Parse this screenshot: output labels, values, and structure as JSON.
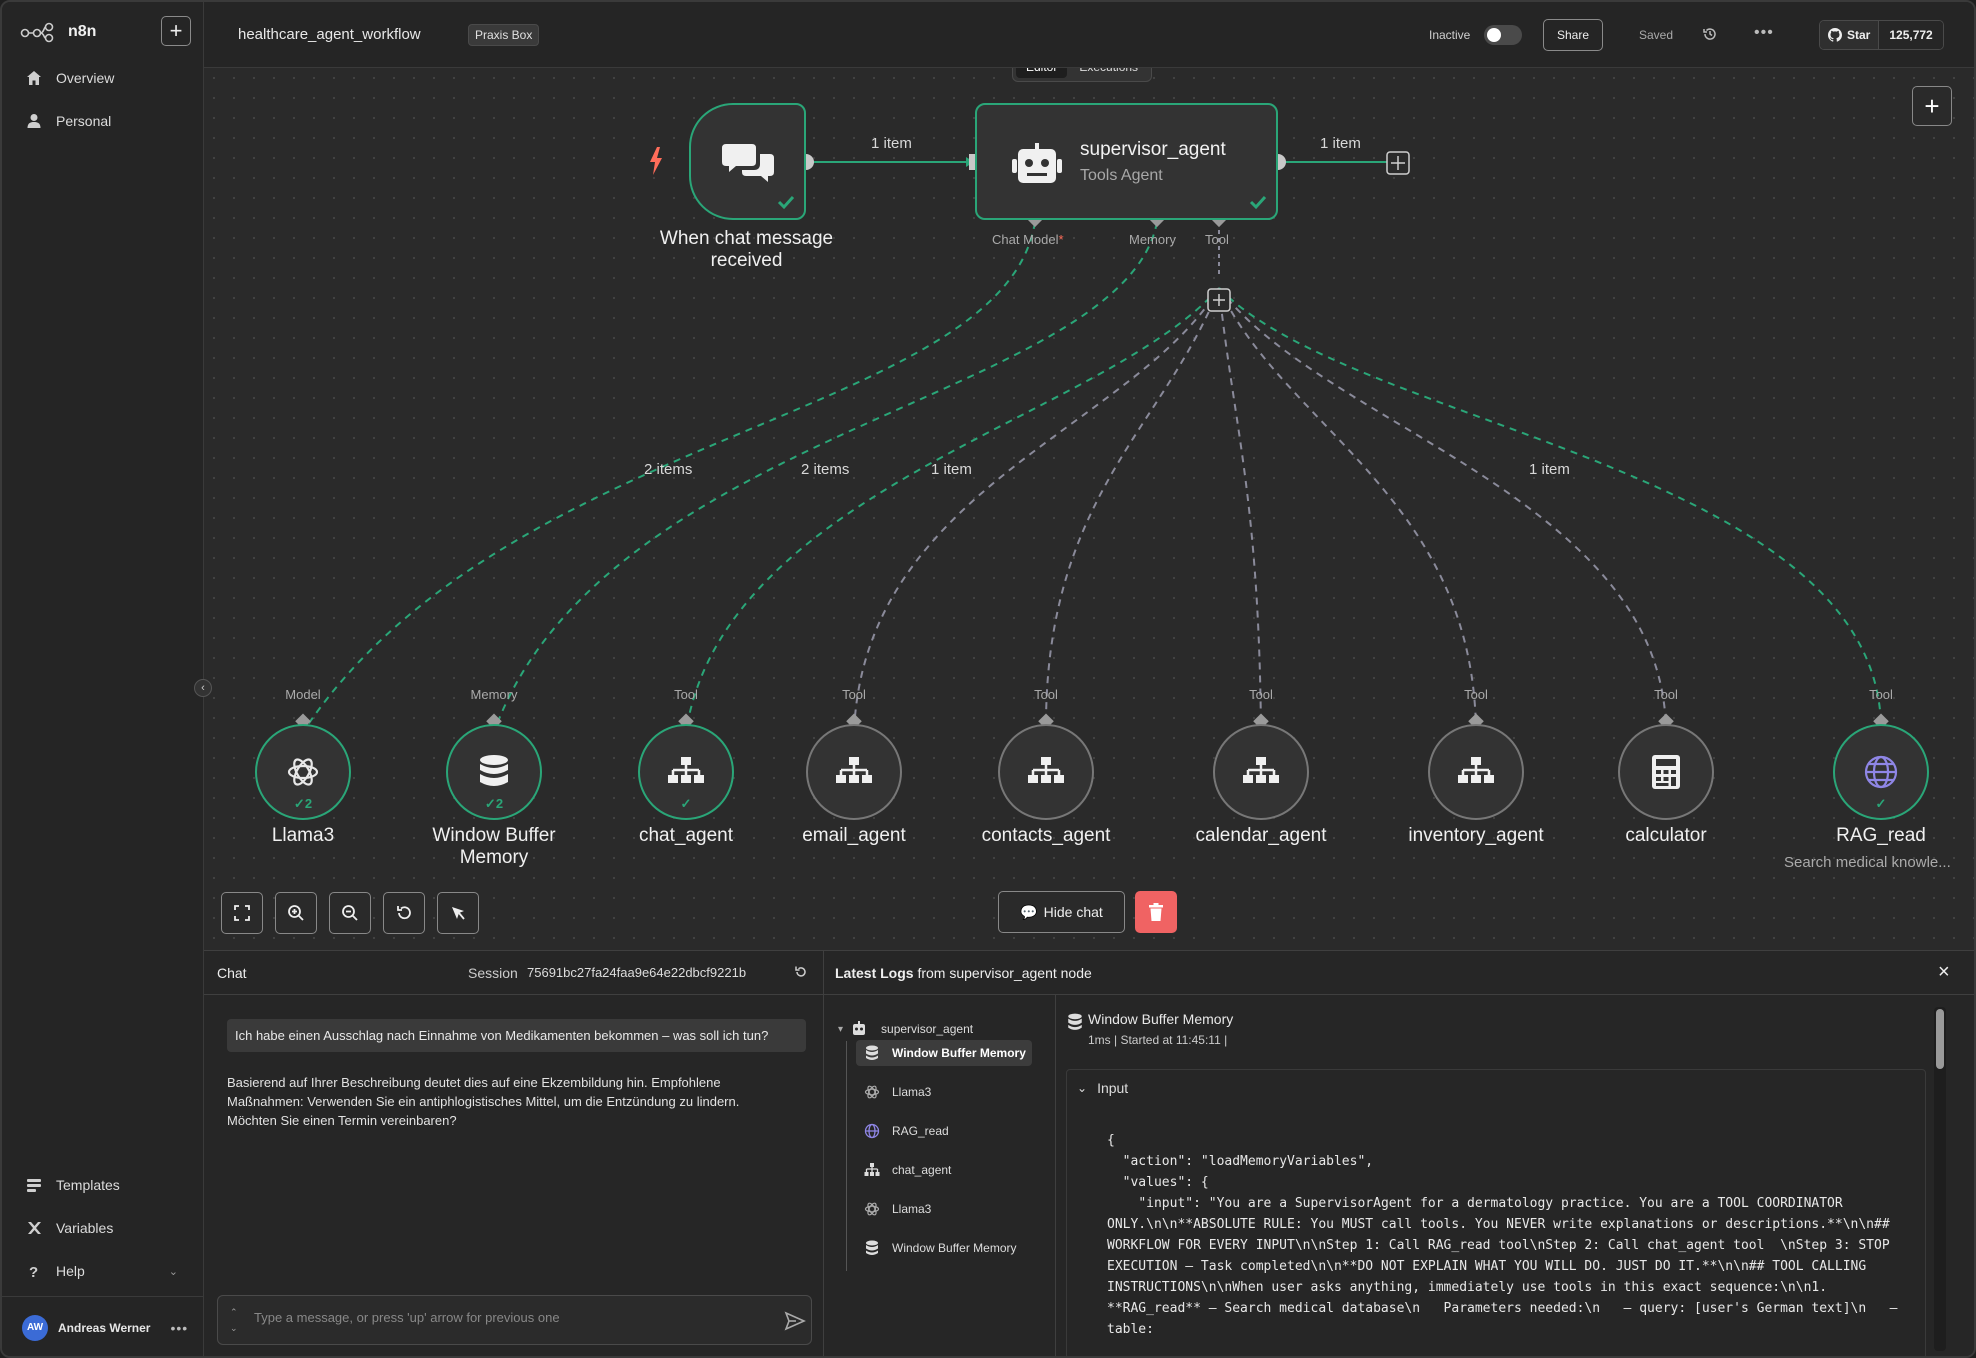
{
  "brand": {
    "name": "n8n"
  },
  "sidebar": {
    "items": [
      {
        "label": "Overview"
      },
      {
        "label": "Personal"
      }
    ],
    "bottom_items": [
      {
        "label": "Templates"
      },
      {
        "label": "Variables"
      },
      {
        "label": "Help"
      }
    ],
    "user": {
      "initials": "AW",
      "name": "Andreas Werner"
    }
  },
  "header": {
    "workflow_name": "healthcare_agent_workflow",
    "tag": "Praxis Box",
    "status_label": "Inactive",
    "share_label": "Share",
    "saved_label": "Saved",
    "github_star": "Star",
    "github_count": "125,772"
  },
  "canvas": {
    "tabs": [
      {
        "label": "Editor",
        "active": true
      },
      {
        "label": "Executions",
        "active": false
      }
    ],
    "trigger": {
      "label_line1": "When chat message",
      "label_line2": "received"
    },
    "agent": {
      "title": "supervisor_agent",
      "subtitle": "Tools Agent"
    },
    "edge_labels": {
      "trigger_to_agent": "1 item",
      "agent_out": "1 item",
      "llama": "2 items",
      "memory": "2 items",
      "chat_agent": "1 item",
      "rag": "1 item"
    },
    "agent_ports": {
      "chat_model": "Chat Model",
      "required_mark": "*",
      "memory": "Memory",
      "tool": "Tool"
    },
    "sub_nodes": [
      {
        "name": "Llama3",
        "port": "Model",
        "icon": "openai-icon",
        "status": "success",
        "badge": "2"
      },
      {
        "name_line1": "Window Buffer",
        "name_line2": "Memory",
        "port": "Memory",
        "icon": "database-icon",
        "status": "success",
        "badge": "2"
      },
      {
        "name": "chat_agent",
        "port": "Tool",
        "icon": "sitemap-icon",
        "status": "success"
      },
      {
        "name": "email_agent",
        "port": "Tool",
        "icon": "sitemap-icon",
        "status": "idle"
      },
      {
        "name": "contacts_agent",
        "port": "Tool",
        "icon": "sitemap-icon",
        "status": "idle"
      },
      {
        "name": "calendar_agent",
        "port": "Tool",
        "icon": "sitemap-icon",
        "status": "idle"
      },
      {
        "name": "inventory_agent",
        "port": "Tool",
        "icon": "sitemap-icon",
        "status": "idle"
      },
      {
        "name": "calculator",
        "port": "Tool",
        "icon": "calculator-icon",
        "status": "idle"
      },
      {
        "name": "RAG_read",
        "port": "Tool",
        "icon": "globe-icon",
        "status": "success",
        "subtitle": "Search medical knowle..."
      }
    ],
    "hide_chat_label": "Hide chat",
    "colors": {
      "success": "#2aa678",
      "delete": "#f06363"
    }
  },
  "chat": {
    "title": "Chat",
    "session_label": "Session",
    "session_id": "75691bc27fa24faa9e64e22dbcf9221b",
    "user_message": "Ich habe einen Ausschlag nach Einnahme von Medikamenten bekommen – was soll ich tun?",
    "bot_message": "Basierend auf Ihrer Beschreibung deutet dies auf eine Ekzembildung hin. Empfohlene Maßnahmen: Verwenden Sie ein antiphlogistisches Mittel, um die Entzündung zu lindern. Möchten Sie einen Termin vereinbaren?",
    "input_placeholder": "Type a message, or press 'up' arrow for previous one"
  },
  "logs": {
    "title_bold": "Latest Logs",
    "title_rest": "from supervisor_agent node",
    "tree_root": "supervisor_agent",
    "tree_items": [
      {
        "label": "Window Buffer Memory",
        "icon": "database-icon",
        "selected": true
      },
      {
        "label": "Llama3",
        "icon": "openai-icon",
        "selected": false
      },
      {
        "label": "RAG_read",
        "icon": "globe-icon",
        "selected": false
      },
      {
        "label": "chat_agent",
        "icon": "sitemap-icon",
        "selected": false
      },
      {
        "label": "Llama3",
        "icon": "openai-icon",
        "selected": false
      },
      {
        "label": "Window Buffer Memory",
        "icon": "database-icon",
        "selected": false
      }
    ],
    "detail_title": "Window Buffer Memory",
    "detail_meta": "1ms | Started at 11:45:11 |",
    "input_label": "Input",
    "json_text": "{\n  \"action\": \"loadMemoryVariables\",\n  \"values\": {\n    \"input\": \"You are a SupervisorAgent for a dermatology practice. You are a TOOL COORDINATOR ONLY.\\n\\n**ABSOLUTE RULE: You MUST call tools. You NEVER write explanations or descriptions.**\\n\\n## WORKFLOW FOR EVERY INPUT\\n\\nStep 1: Call RAG_read tool\\nStep 2: Call chat_agent tool  \\nStep 3: STOP EXECUTION – Task completed\\n\\n**DO NOT EXPLAIN WHAT YOU WILL DO. JUST DO IT.**\\n\\n## TOOL CALLING INSTRUCTIONS\\n\\nWhen user asks anything, immediately use tools in this exact sequence:\\n\\n1. **RAG_read** – Search medical database\\n   Parameters needed:\\n   – query: [user's German text]\\n   – table:"
  }
}
